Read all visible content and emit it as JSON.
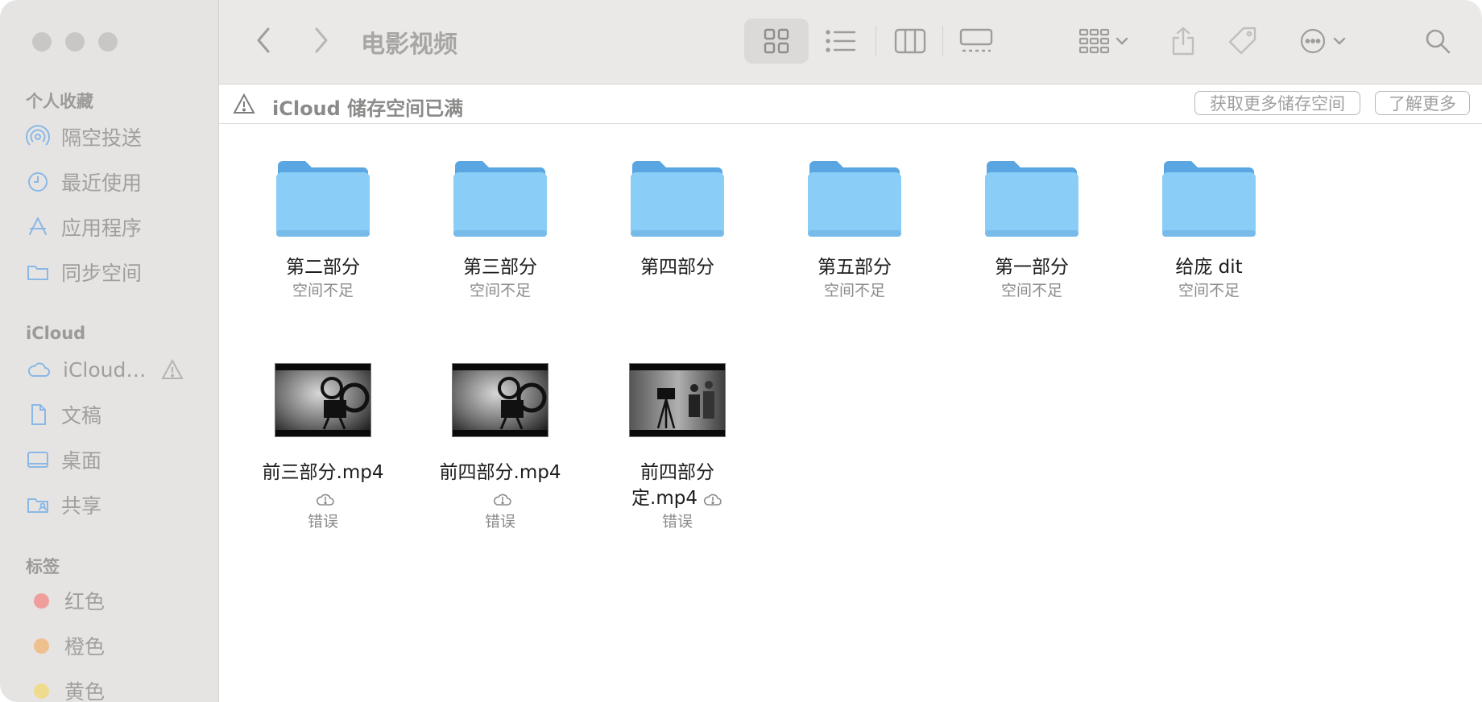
{
  "window": {
    "title": "电影视频"
  },
  "sidebar": {
    "favorites_title": "个人收藏",
    "favorites": [
      {
        "label": "隔空投送",
        "icon": "airdrop-icon"
      },
      {
        "label": "最近使用",
        "icon": "clock-icon"
      },
      {
        "label": "应用程序",
        "icon": "applications-icon"
      },
      {
        "label": "同步空间",
        "icon": "folder-icon"
      }
    ],
    "icloud_title": "iCloud",
    "icloud": [
      {
        "label": "iCloud…",
        "icon": "cloud-icon"
      },
      {
        "label": "文稿",
        "icon": "document-icon"
      },
      {
        "label": "桌面",
        "icon": "desktop-icon"
      },
      {
        "label": "共享",
        "icon": "shared-folder-icon"
      }
    ],
    "tags_title": "标签",
    "tags": [
      {
        "label": "红色",
        "color": "#ef9e9c"
      },
      {
        "label": "橙色",
        "color": "#eec08e"
      },
      {
        "label": "黄色",
        "color": "#eedb8e"
      }
    ]
  },
  "banner": {
    "text": "iCloud 储存空间已满",
    "btn_more_storage": "获取更多储存空间",
    "btn_learn_more": "了解更多"
  },
  "folders": [
    {
      "name": "第二部分",
      "sub": "空间不足"
    },
    {
      "name": "第三部分",
      "sub": "空间不足"
    },
    {
      "name": "第四部分",
      "sub": ""
    },
    {
      "name": "第五部分",
      "sub": "空间不足"
    },
    {
      "name": "第一部分",
      "sub": "空间不足"
    },
    {
      "name": "给庞 dit",
      "sub": "空间不足"
    }
  ],
  "videos": [
    {
      "name": "前三部分.mp4",
      "sub": "错误"
    },
    {
      "name": "前四部分.mp4",
      "sub": "错误"
    },
    {
      "name_line1": "前四部分",
      "name_line2": "定.mp4",
      "sub": "错误"
    }
  ],
  "colors": {
    "folder_top": "#5aa6e2",
    "folder_body": "#8acdf6",
    "sidebar_bg": "#e6e4e3"
  }
}
